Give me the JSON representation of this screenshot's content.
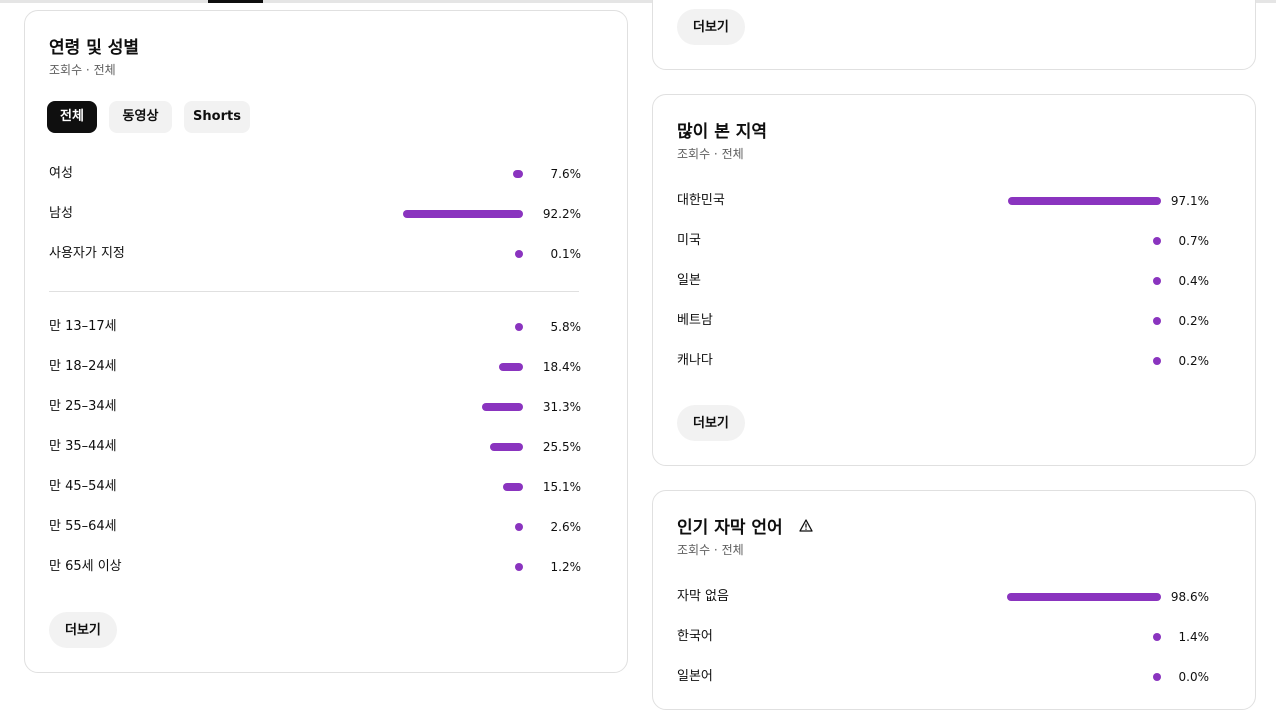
{
  "colors": {
    "bar": "#8a34bf",
    "chip_active_bg": "#0f0f0f",
    "chip_bg": "#f2f2f2"
  },
  "age_gender": {
    "title": "연령 및 성별",
    "subtitle": "조회수 · 전체",
    "chips": [
      {
        "label": "전체",
        "active": true
      },
      {
        "label": "동영상",
        "active": false
      },
      {
        "label": "Shorts",
        "active": false
      }
    ],
    "gender": [
      {
        "label": "여성",
        "value": 7.6,
        "pct": "7.6%"
      },
      {
        "label": "남성",
        "value": 92.2,
        "pct": "92.2%"
      },
      {
        "label": "사용자가 지정",
        "value": 0.1,
        "pct": "0.1%"
      }
    ],
    "age": [
      {
        "label": "만 13–17세",
        "value": 5.8,
        "pct": "5.8%"
      },
      {
        "label": "만 18–24세",
        "value": 18.4,
        "pct": "18.4%"
      },
      {
        "label": "만 25–34세",
        "value": 31.3,
        "pct": "31.3%"
      },
      {
        "label": "만 35–44세",
        "value": 25.5,
        "pct": "25.5%"
      },
      {
        "label": "만 45–54세",
        "value": 15.1,
        "pct": "15.1%"
      },
      {
        "label": "만 55–64세",
        "value": 2.6,
        "pct": "2.6%"
      },
      {
        "label": "만 65세 이상",
        "value": 1.2,
        "pct": "1.2%"
      }
    ],
    "more_label": "더보기"
  },
  "top_card": {
    "more_label": "더보기"
  },
  "regions": {
    "title": "많이 본 지역",
    "subtitle": "조회수 · 전체",
    "rows": [
      {
        "label": "대한민국",
        "value": 97.1,
        "pct": "97.1%"
      },
      {
        "label": "미국",
        "value": 0.7,
        "pct": "0.7%"
      },
      {
        "label": "일본",
        "value": 0.4,
        "pct": "0.4%"
      },
      {
        "label": "베트남",
        "value": 0.2,
        "pct": "0.2%"
      },
      {
        "label": "캐나다",
        "value": 0.2,
        "pct": "0.2%"
      }
    ],
    "more_label": "더보기"
  },
  "subtitles": {
    "title": "인기 자막 언어",
    "subtitle": "조회수 · 전체",
    "warning_icon": "warning-triangle-icon",
    "rows": [
      {
        "label": "자막 없음",
        "value": 98.6,
        "pct": "98.6%"
      },
      {
        "label": "한국어",
        "value": 1.4,
        "pct": "1.4%"
      },
      {
        "label": "일본어",
        "value": 0.0,
        "pct": "0.0%"
      }
    ]
  }
}
